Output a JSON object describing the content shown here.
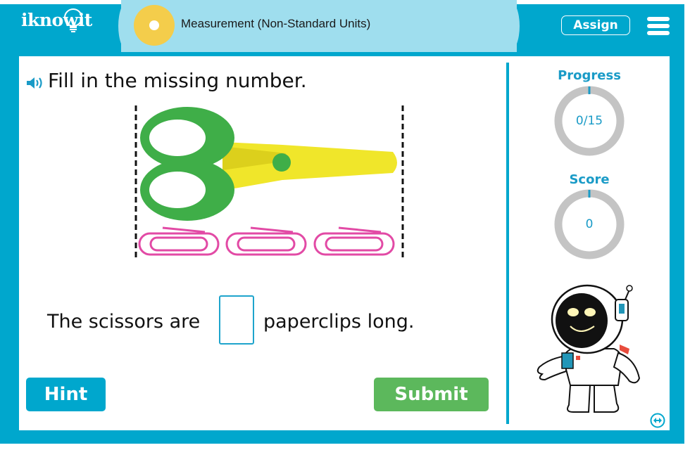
{
  "header": {
    "logo_text": "iknowit",
    "topic_title": "Measurement (Non-Standard Units)",
    "assign_label": "Assign",
    "menu_icon": "hamburger-menu-icon"
  },
  "question": {
    "audio_icon": "speaker-icon",
    "prompt": "Fill in the missing number.",
    "illustration": {
      "object": "scissors",
      "unit": "paperclip",
      "unit_count_shown": 3
    },
    "sentence_before": "The scissors are",
    "answer_value": "",
    "sentence_after": "paperclips long."
  },
  "actions": {
    "hint_label": "Hint",
    "submit_label": "Submit"
  },
  "sidebar": {
    "progress_label": "Progress",
    "progress_value": "0/15",
    "progress_fraction": 0,
    "score_label": "Score",
    "score_value": "0",
    "score_fraction": 0,
    "expand_icon": "expand-arrows-icon"
  },
  "colors": {
    "brand_blue": "#00a7cd",
    "pill_light_blue": "#9fdeee",
    "topic_yellow": "#f4cd4b",
    "submit_green": "#5cb85c",
    "gauge_track": "#c4c4c4",
    "accent_text": "#1a9bc7"
  }
}
